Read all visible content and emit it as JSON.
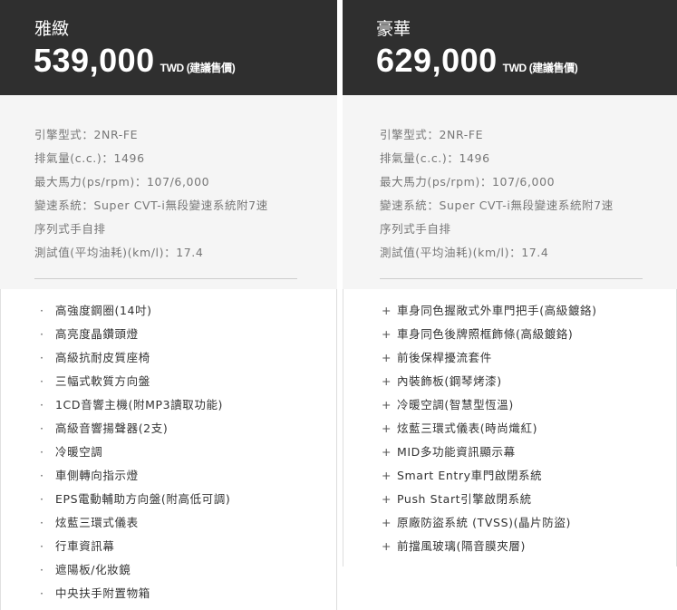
{
  "trims": [
    {
      "name": "雅緻",
      "price": "539,000",
      "unit": "TWD (建議售價)",
      "specs": [
        "引擎型式：2NR-FE",
        "排氣量(c.c.)：1496",
        "最大馬力(ps/rpm)：107/6,000",
        "變速系統：Super CVT-i無段變速系統附7速",
        "序列式手自排",
        "測試值(平均油耗)(km/l)：17.4"
      ],
      "feature_marker": "·",
      "features": [
        "高強度鋼圈(14吋)",
        "高亮度晶鑽頭燈",
        "高級抗耐皮質座椅",
        "三幅式軟質方向盤",
        "1CD音響主機(附MP3讀取功能)",
        "高級音響揚聲器(2支)",
        "冷暖空調",
        "車側轉向指示燈",
        "EPS電動輔助方向盤(附高低可調)",
        "炫藍三環式儀表",
        "行車資訊幕",
        "遮陽板/化妝鏡",
        "中央扶手附置物箱"
      ]
    },
    {
      "name": "豪華",
      "price": "629,000",
      "unit": "TWD (建議售價)",
      "specs": [
        "引擎型式：2NR-FE",
        "排氣量(c.c.)：1496",
        "最大馬力(ps/rpm)：107/6,000",
        "變速系統：Super CVT-i無段變速系統附7速",
        "序列式手自排",
        "測試值(平均油耗)(km/l)：17.4"
      ],
      "feature_marker": "+",
      "features": [
        "車身同色握敞式外車門把手(高級鍍鉻)",
        "車身同色後牌照框飾條(高級鍍鉻)",
        "前後保桿擾流套件",
        "內裝飾板(鋼琴烤漆)",
        "冷暖空調(智慧型恆溫)",
        "炫藍三環式儀表(時尚熾紅)",
        "MID多功能資訊顯示幕",
        "Smart Entry車門啟閉系統",
        "Push Start引擎啟閉系統",
        "原廠防盜系統 (TVSS)(晶片防盜)",
        "前擋風玻璃(隔音膜夾層)"
      ]
    }
  ]
}
